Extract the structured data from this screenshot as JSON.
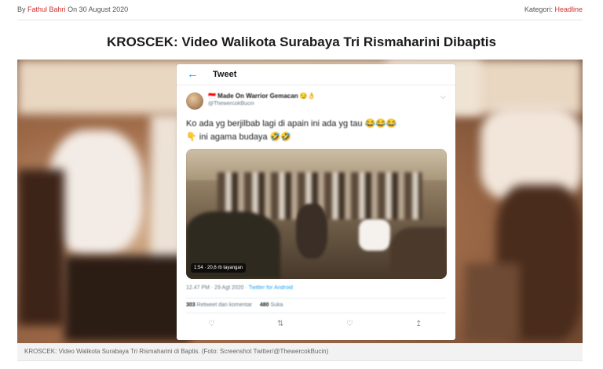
{
  "meta": {
    "by_label": "By",
    "author": "Fathul Bahri",
    "on_label": "On",
    "date": "30 August 2020",
    "category_label": "Kategori:",
    "category": "Headline"
  },
  "article": {
    "title": "KROSCEK: Video Walikota Surabaya Tri Rismaharini Dibaptis",
    "caption": "KROSCEK: Video Walikota Surabaya Tri Rismaharini di Baptis. (Foto: Screenshot Twitter/@ThewercokBucin)"
  },
  "tweet": {
    "header_title": "Tweet",
    "back_icon": "arrow-left-icon",
    "user_name": "🇮🇩 Made On Warrior Gemacan 😏👌",
    "user_handle": "@ThewercokBucin",
    "text_line1": "Ko ada yg berjilbab lagi di apain ini ada yg tau 😂😂😂",
    "text_line2": "👇 ini agama budaya 🤣🤣",
    "media_badge": "1:54 · 20,6 rb tayangan",
    "time": "12.47 PM · 29 Agt 2020 ·",
    "source": "Twitter for Android",
    "retweets": "303",
    "retweets_label": "Retweet dan komentar",
    "likes": "480",
    "likes_label": "Suka",
    "actions": [
      "reply-icon",
      "retweet-icon",
      "like-icon",
      "share-icon"
    ]
  },
  "colors": {
    "accent_red": "#d32f2f",
    "twitter_blue": "#1da1f2"
  }
}
